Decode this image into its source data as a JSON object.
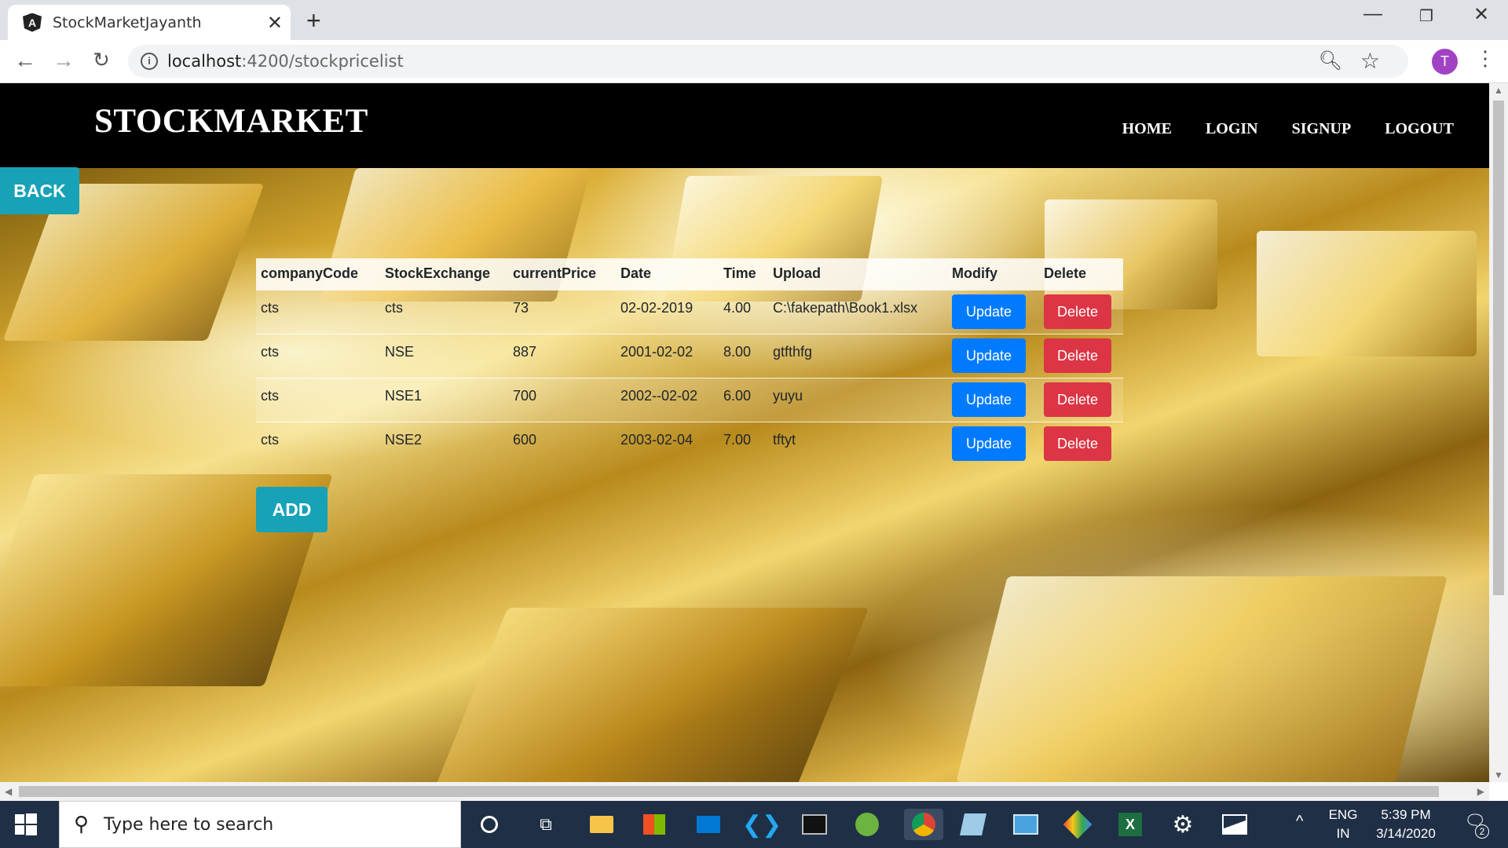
{
  "browser": {
    "tab_title": "StockMarketJayanth",
    "favicon_letter": "A",
    "url_host": "localhost",
    "url_path": ":4200/stockpricelist",
    "profile_initial": "T"
  },
  "site": {
    "brand": "STOCKMARKET",
    "nav": [
      "HOME",
      "LOGIN",
      "SIGNUP",
      "LOGOUT"
    ],
    "back_label": "BACK",
    "add_label": "ADD"
  },
  "table": {
    "headers": [
      "companyCode",
      "StockExchange",
      "currentPrice",
      "Date",
      "Time",
      "Upload",
      "Modify",
      "Delete"
    ],
    "update_label": "Update",
    "delete_label": "Delete",
    "rows": [
      {
        "companyCode": "cts",
        "exchange": "cts",
        "price": "73",
        "date": "02-02-2019",
        "time": "4.00",
        "upload": "C:\\fakepath\\Book1.xlsx"
      },
      {
        "companyCode": "cts",
        "exchange": "NSE",
        "price": "887",
        "date": "2001-02-02",
        "time": "8.00",
        "upload": "gtfthfg"
      },
      {
        "companyCode": "cts",
        "exchange": "NSE1",
        "price": "700",
        "date": "2002--02-02",
        "time": "6.00",
        "upload": "yuyu"
      },
      {
        "companyCode": "cts",
        "exchange": "NSE2",
        "price": "600",
        "date": "2003-02-04",
        "time": "7.00",
        "upload": "tftyt"
      }
    ]
  },
  "taskbar": {
    "search_placeholder": "Type here to search",
    "lang": "ENG",
    "region": "IN",
    "time": "5:39 PM",
    "date": "3/14/2020",
    "notifications": "2"
  },
  "colors": {
    "header_bg": "#000000",
    "info_button": "#17a2b8",
    "update_button": "#007bff",
    "delete_button": "#dc3545"
  }
}
